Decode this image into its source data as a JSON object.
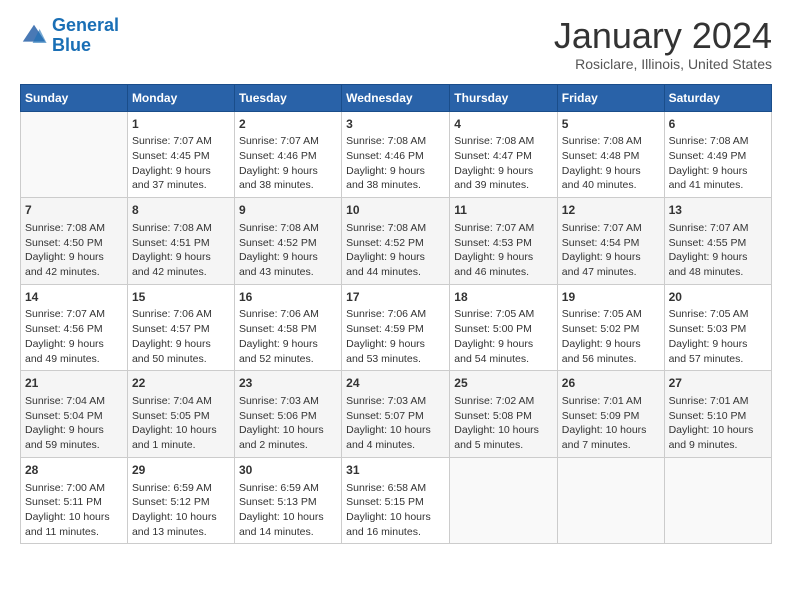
{
  "header": {
    "logo_line1": "General",
    "logo_line2": "Blue",
    "title": "January 2024",
    "subtitle": "Rosiclare, Illinois, United States"
  },
  "days_of_week": [
    "Sunday",
    "Monday",
    "Tuesday",
    "Wednesday",
    "Thursday",
    "Friday",
    "Saturday"
  ],
  "weeks": [
    [
      {
        "day": "",
        "sunrise": "",
        "sunset": "",
        "daylight": ""
      },
      {
        "day": "1",
        "sunrise": "Sunrise: 7:07 AM",
        "sunset": "Sunset: 4:45 PM",
        "daylight": "Daylight: 9 hours and 37 minutes."
      },
      {
        "day": "2",
        "sunrise": "Sunrise: 7:07 AM",
        "sunset": "Sunset: 4:46 PM",
        "daylight": "Daylight: 9 hours and 38 minutes."
      },
      {
        "day": "3",
        "sunrise": "Sunrise: 7:08 AM",
        "sunset": "Sunset: 4:46 PM",
        "daylight": "Daylight: 9 hours and 38 minutes."
      },
      {
        "day": "4",
        "sunrise": "Sunrise: 7:08 AM",
        "sunset": "Sunset: 4:47 PM",
        "daylight": "Daylight: 9 hours and 39 minutes."
      },
      {
        "day": "5",
        "sunrise": "Sunrise: 7:08 AM",
        "sunset": "Sunset: 4:48 PM",
        "daylight": "Daylight: 9 hours and 40 minutes."
      },
      {
        "day": "6",
        "sunrise": "Sunrise: 7:08 AM",
        "sunset": "Sunset: 4:49 PM",
        "daylight": "Daylight: 9 hours and 41 minutes."
      }
    ],
    [
      {
        "day": "7",
        "sunrise": "Sunrise: 7:08 AM",
        "sunset": "Sunset: 4:50 PM",
        "daylight": "Daylight: 9 hours and 42 minutes."
      },
      {
        "day": "8",
        "sunrise": "Sunrise: 7:08 AM",
        "sunset": "Sunset: 4:51 PM",
        "daylight": "Daylight: 9 hours and 42 minutes."
      },
      {
        "day": "9",
        "sunrise": "Sunrise: 7:08 AM",
        "sunset": "Sunset: 4:52 PM",
        "daylight": "Daylight: 9 hours and 43 minutes."
      },
      {
        "day": "10",
        "sunrise": "Sunrise: 7:08 AM",
        "sunset": "Sunset: 4:52 PM",
        "daylight": "Daylight: 9 hours and 44 minutes."
      },
      {
        "day": "11",
        "sunrise": "Sunrise: 7:07 AM",
        "sunset": "Sunset: 4:53 PM",
        "daylight": "Daylight: 9 hours and 46 minutes."
      },
      {
        "day": "12",
        "sunrise": "Sunrise: 7:07 AM",
        "sunset": "Sunset: 4:54 PM",
        "daylight": "Daylight: 9 hours and 47 minutes."
      },
      {
        "day": "13",
        "sunrise": "Sunrise: 7:07 AM",
        "sunset": "Sunset: 4:55 PM",
        "daylight": "Daylight: 9 hours and 48 minutes."
      }
    ],
    [
      {
        "day": "14",
        "sunrise": "Sunrise: 7:07 AM",
        "sunset": "Sunset: 4:56 PM",
        "daylight": "Daylight: 9 hours and 49 minutes."
      },
      {
        "day": "15",
        "sunrise": "Sunrise: 7:06 AM",
        "sunset": "Sunset: 4:57 PM",
        "daylight": "Daylight: 9 hours and 50 minutes."
      },
      {
        "day": "16",
        "sunrise": "Sunrise: 7:06 AM",
        "sunset": "Sunset: 4:58 PM",
        "daylight": "Daylight: 9 hours and 52 minutes."
      },
      {
        "day": "17",
        "sunrise": "Sunrise: 7:06 AM",
        "sunset": "Sunset: 4:59 PM",
        "daylight": "Daylight: 9 hours and 53 minutes."
      },
      {
        "day": "18",
        "sunrise": "Sunrise: 7:05 AM",
        "sunset": "Sunset: 5:00 PM",
        "daylight": "Daylight: 9 hours and 54 minutes."
      },
      {
        "day": "19",
        "sunrise": "Sunrise: 7:05 AM",
        "sunset": "Sunset: 5:02 PM",
        "daylight": "Daylight: 9 hours and 56 minutes."
      },
      {
        "day": "20",
        "sunrise": "Sunrise: 7:05 AM",
        "sunset": "Sunset: 5:03 PM",
        "daylight": "Daylight: 9 hours and 57 minutes."
      }
    ],
    [
      {
        "day": "21",
        "sunrise": "Sunrise: 7:04 AM",
        "sunset": "Sunset: 5:04 PM",
        "daylight": "Daylight: 9 hours and 59 minutes."
      },
      {
        "day": "22",
        "sunrise": "Sunrise: 7:04 AM",
        "sunset": "Sunset: 5:05 PM",
        "daylight": "Daylight: 10 hours and 1 minute."
      },
      {
        "day": "23",
        "sunrise": "Sunrise: 7:03 AM",
        "sunset": "Sunset: 5:06 PM",
        "daylight": "Daylight: 10 hours and 2 minutes."
      },
      {
        "day": "24",
        "sunrise": "Sunrise: 7:03 AM",
        "sunset": "Sunset: 5:07 PM",
        "daylight": "Daylight: 10 hours and 4 minutes."
      },
      {
        "day": "25",
        "sunrise": "Sunrise: 7:02 AM",
        "sunset": "Sunset: 5:08 PM",
        "daylight": "Daylight: 10 hours and 5 minutes."
      },
      {
        "day": "26",
        "sunrise": "Sunrise: 7:01 AM",
        "sunset": "Sunset: 5:09 PM",
        "daylight": "Daylight: 10 hours and 7 minutes."
      },
      {
        "day": "27",
        "sunrise": "Sunrise: 7:01 AM",
        "sunset": "Sunset: 5:10 PM",
        "daylight": "Daylight: 10 hours and 9 minutes."
      }
    ],
    [
      {
        "day": "28",
        "sunrise": "Sunrise: 7:00 AM",
        "sunset": "Sunset: 5:11 PM",
        "daylight": "Daylight: 10 hours and 11 minutes."
      },
      {
        "day": "29",
        "sunrise": "Sunrise: 6:59 AM",
        "sunset": "Sunset: 5:12 PM",
        "daylight": "Daylight: 10 hours and 13 minutes."
      },
      {
        "day": "30",
        "sunrise": "Sunrise: 6:59 AM",
        "sunset": "Sunset: 5:13 PM",
        "daylight": "Daylight: 10 hours and 14 minutes."
      },
      {
        "day": "31",
        "sunrise": "Sunrise: 6:58 AM",
        "sunset": "Sunset: 5:15 PM",
        "daylight": "Daylight: 10 hours and 16 minutes."
      },
      {
        "day": "",
        "sunrise": "",
        "sunset": "",
        "daylight": ""
      },
      {
        "day": "",
        "sunrise": "",
        "sunset": "",
        "daylight": ""
      },
      {
        "day": "",
        "sunrise": "",
        "sunset": "",
        "daylight": ""
      }
    ]
  ]
}
